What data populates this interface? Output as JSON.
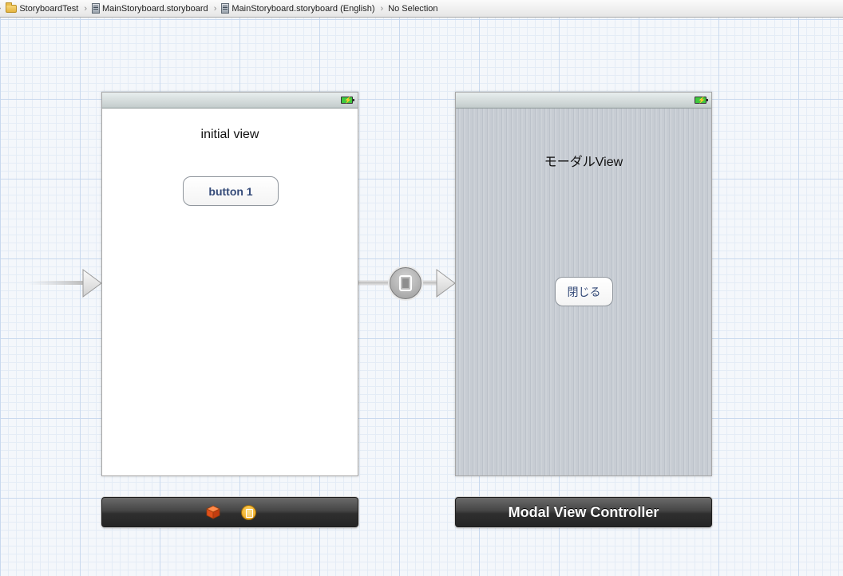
{
  "breadcrumb": {
    "items": [
      {
        "label": "StoryboardTest",
        "icon": "folder-icon"
      },
      {
        "label": "MainStoryboard.storyboard",
        "icon": "storyboard-file-icon"
      },
      {
        "label": "MainStoryboard.storyboard (English)",
        "icon": "storyboard-file-icon"
      },
      {
        "label": "No Selection"
      }
    ]
  },
  "scenes": {
    "initial": {
      "label": "initial view",
      "button_label": "button 1",
      "dock_icons": [
        "first-responder-cube-icon",
        "view-controller-icon"
      ]
    },
    "modal": {
      "label": "モーダルView",
      "button_label": "閉じる",
      "dock_title": "Modal View Controller"
    }
  },
  "segue": {
    "icon": "modal-segue-icon"
  },
  "colors": {
    "canvas": "#f4f7fb",
    "grid": "#c9d9ee",
    "modal_background": "#c7ccd3",
    "button_text": "#344a78",
    "dock": "#3a3a3a"
  }
}
